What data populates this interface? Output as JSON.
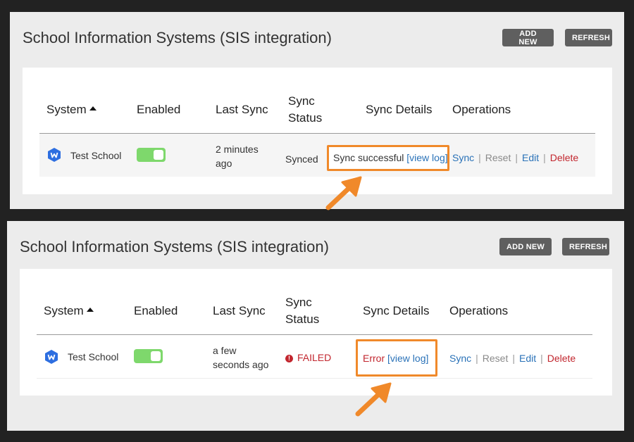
{
  "colors": {
    "background": "#222222",
    "panel": "#ececec",
    "button": "#5f5f5f",
    "toggle_on": "#7ed86c",
    "link_blue": "#2a72b8",
    "error_red": "#c2262e",
    "highlight_orange": "#f0892a"
  },
  "panels": [
    {
      "title": "School Information Systems (SIS integration)",
      "buttons": {
        "add_new": "ADD NEW",
        "refresh": "REFRESH"
      },
      "columns": {
        "system": "System",
        "enabled": "Enabled",
        "last_sync": "Last Sync",
        "sync_status_1": "Sync",
        "sync_status_2": "Status",
        "sync_details": "Sync Details",
        "operations": "Operations"
      },
      "row": {
        "school_icon": "w-hexagon-icon",
        "school_name": "Test School",
        "enabled": true,
        "last_sync_1": "2 minutes",
        "last_sync_2": "ago",
        "status": "Synced",
        "details_text": "Sync successful",
        "view_log": "[view log]",
        "ops": {
          "sync": "Sync",
          "reset": "Reset",
          "edit": "Edit",
          "delete": "Delete",
          "separator": "|"
        }
      }
    },
    {
      "title": "School Information Systems (SIS integration)",
      "buttons": {
        "add_new": "ADD NEW",
        "refresh": "REFRESH"
      },
      "columns": {
        "system": "System",
        "enabled": "Enabled",
        "last_sync": "Last Sync",
        "sync_status_1": "Sync",
        "sync_status_2": "Status",
        "sync_details": "Sync Details",
        "operations": "Operations"
      },
      "row": {
        "school_icon": "w-hexagon-icon",
        "school_name": "Test School",
        "enabled": true,
        "last_sync_1": "a few",
        "last_sync_2": "seconds ago",
        "status_icon": "error-circle-icon",
        "status_icon_glyph": "!",
        "status": "FAILED",
        "details_text": "Error",
        "view_log": "[view log]",
        "ops": {
          "sync": "Sync",
          "reset": "Reset",
          "edit": "Edit",
          "delete": "Delete",
          "separator": "|"
        }
      }
    }
  ]
}
